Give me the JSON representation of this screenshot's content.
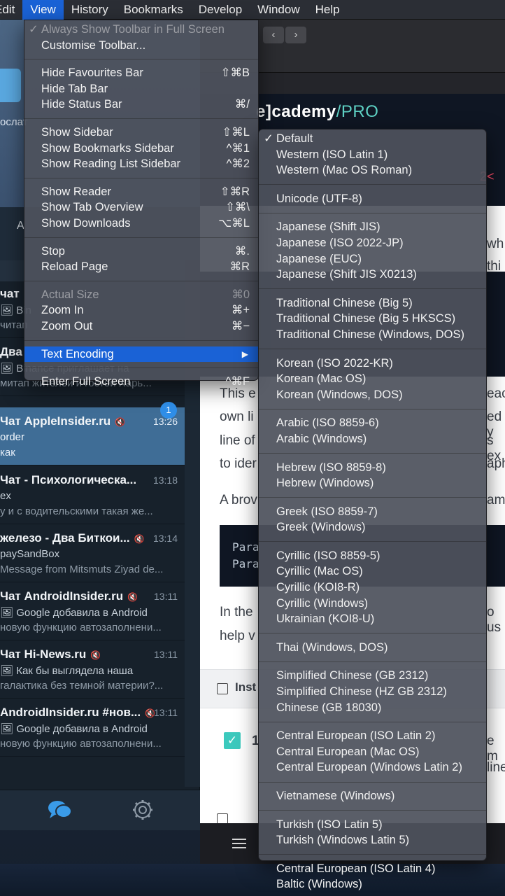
{
  "menubar": {
    "items": [
      {
        "label": "Edit"
      },
      {
        "label": "View"
      },
      {
        "label": "History"
      },
      {
        "label": "Bookmarks"
      },
      {
        "label": "Develop"
      },
      {
        "label": "Window"
      },
      {
        "label": "Help"
      }
    ]
  },
  "view_menu": {
    "always_show_toolbar": "Always Show Toolbar in Full Screen",
    "customise_toolbar": "Customise Toolbar...",
    "hide_favourites": {
      "label": "Hide Favourites Bar",
      "shortcut": "⇧⌘B"
    },
    "hide_tab_bar": {
      "label": "Hide Tab Bar"
    },
    "hide_status_bar": {
      "label": "Hide Status Bar",
      "shortcut": "⌘/"
    },
    "show_sidebar": {
      "label": "Show Sidebar",
      "shortcut": "⇧⌘L"
    },
    "show_bookmarks_sidebar": {
      "label": "Show Bookmarks Sidebar",
      "shortcut": "^⌘1"
    },
    "show_reading_list_sidebar": {
      "label": "Show Reading List Sidebar",
      "shortcut": "^⌘2"
    },
    "show_reader": {
      "label": "Show Reader",
      "shortcut": "⇧⌘R"
    },
    "show_tab_overview": {
      "label": "Show Tab Overview",
      "shortcut": "⇧⌘\\"
    },
    "show_downloads": {
      "label": "Show Downloads",
      "shortcut": "⌥⌘L"
    },
    "stop": {
      "label": "Stop",
      "shortcut": "⌘."
    },
    "reload_page": {
      "label": "Reload Page",
      "shortcut": "⌘R"
    },
    "actual_size": {
      "label": "Actual Size",
      "shortcut": "⌘0"
    },
    "zoom_in": {
      "label": "Zoom In",
      "shortcut": "⌘+"
    },
    "zoom_out": {
      "label": "Zoom Out",
      "shortcut": "⌘−"
    },
    "text_encoding": {
      "label": "Text Encoding",
      "arrow": "▶"
    },
    "enter_full_screen": {
      "label": "Enter Full Screen",
      "shortcut": "^⌘F"
    },
    "check": "✓"
  },
  "encoding_menu": {
    "check": "✓",
    "groups": [
      [
        "Default",
        "Western (ISO Latin 1)",
        "Western (Mac OS Roman)"
      ],
      [
        "Unicode (UTF-8)"
      ],
      [
        "Japanese (Shift JIS)",
        "Japanese (ISO 2022-JP)",
        "Japanese (EUC)",
        "Japanese (Shift JIS X0213)"
      ],
      [
        "Traditional Chinese (Big 5)",
        "Traditional Chinese (Big 5 HKSCS)",
        "Traditional Chinese (Windows, DOS)"
      ],
      [
        "Korean (ISO 2022-KR)",
        "Korean (Mac OS)",
        "Korean (Windows, DOS)"
      ],
      [
        "Arabic (ISO 8859-6)",
        "Arabic (Windows)"
      ],
      [
        "Hebrew (ISO 8859-8)",
        "Hebrew (Windows)"
      ],
      [
        "Greek (ISO 8859-7)",
        "Greek (Windows)"
      ],
      [
        "Cyrillic (ISO 8859-5)",
        "Cyrillic (Mac OS)",
        "Cyrillic (KOI8-R)",
        "Cyrillic (Windows)",
        "Ukrainian (KOI8-U)"
      ],
      [
        "Thai (Windows, DOS)"
      ],
      [
        "Simplified Chinese (GB 2312)",
        "Simplified Chinese (HZ GB 2312)",
        "Chinese (GB 18030)"
      ],
      [
        "Central European (ISO Latin 2)",
        "Central European (Mac OS)",
        "Central European (Windows Latin 2)"
      ],
      [
        "Vietnamese (Windows)"
      ],
      [
        "Turkish (ISO Latin 5)",
        "Turkish (Windows Latin 5)"
      ],
      [
        "Central European (ISO Latin 4)",
        "Baltic (Windows)"
      ]
    ]
  },
  "telegram": {
    "top_label": "ослат",
    "tab_letter": "А",
    "badge": "1",
    "chats": [
      {
        "title": "чат",
        "time": "",
        "l1": "🖼 Bin",
        "l2": "читап"
      },
      {
        "title": "Два Б",
        "time": "",
        "l1": "🖼 Binance приглашает на",
        "l2": "митап жителей и гостей Харь..."
      },
      {
        "title": "Чат AppleInsider.ru",
        "time": "13:26",
        "l1": "order",
        "l2": "как"
      },
      {
        "title": "Чат - Психологическа...",
        "time": "13:18",
        "l1": "ex",
        "l2": "у и с водительскими такая же..."
      },
      {
        "title": "железо - Два Биткои...",
        "time": "13:14",
        "l1": "paySandBox",
        "l2": "Message from Mitsmuts Ziyad de..."
      },
      {
        "title": "Чат AndroidInsider.ru",
        "time": "13:11",
        "l1": "🖼 Google добавила в Android",
        "l2": "новую функцию автозаполнени..."
      },
      {
        "title": "Чат Hi-News.ru",
        "time": "13:11",
        "l1": "🖼 Как бы выглядела наша",
        "l2": "галактика без темной материи?..."
      },
      {
        "title": "AndroidInsider.ru #нов...",
        "time": "13:11",
        "l1": "🖼 Google добавила в Android",
        "l2": "новую функцию автозаполнени..."
      }
    ]
  },
  "browser": {
    "back": "‹",
    "forward": "›",
    "brand_main": "e]cademy",
    "brand_pro": "/PRO",
    "code_fragment": "2<",
    "snippets": [
      {
        "text": "wh"
      },
      {
        "text": "thi"
      },
      {
        "text": "This e"
      },
      {
        "text": "eac"
      },
      {
        "text": "own li"
      },
      {
        "text": "ed y"
      },
      {
        "text": "line of"
      },
      {
        "text": "s ex"
      },
      {
        "text": "to ider"
      },
      {
        "text": "aph"
      },
      {
        "text": "A brov"
      },
      {
        "text": "ame"
      },
      {
        "text": "In the"
      },
      {
        "text": "o us"
      },
      {
        "text": "help v"
      },
      {
        "text": "Inst"
      },
      {
        "text": "1"
      },
      {
        "text": "e m"
      },
      {
        "text": "line"
      }
    ],
    "code_lines": [
      "Para",
      "Para"
    ],
    "check_glyph": "✓"
  }
}
